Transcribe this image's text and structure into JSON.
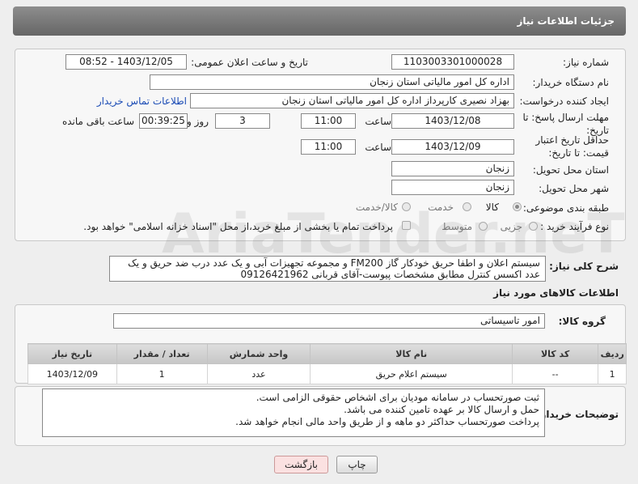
{
  "header": {
    "title": "جزئیات اطلاعات نیاز"
  },
  "form": {
    "need_number_label": "شماره نیاز:",
    "need_number": "1103003301000028",
    "announce_label": "تاریخ و ساعت اعلان عمومی:",
    "announce_value": "1403/12/05 - 08:52",
    "buyer_org_label": "نام دستگاه خریدار:",
    "buyer_org": "اداره کل امور مالیاتی استان زنجان",
    "creator_label": "ایجاد کننده درخواست:",
    "creator": "بهزاد نصیری کارپرداز اداره کل امور مالیاتی استان زنجان",
    "contact_link": "اطلاعات تماس خریدار",
    "deadline_label": "مهلت ارسال پاسخ: تا تاریخ:",
    "deadline_date": "1403/12/08",
    "time_label": "ساعت",
    "deadline_time": "11:00",
    "days_value": "3",
    "days_label": "روز و",
    "remaining_time": "00:39:25",
    "remaining_label": "ساعت باقی مانده",
    "validity_label": "حداقل تاریخ اعتبار قیمت: تا تاریخ:",
    "validity_date": "1403/12/09",
    "validity_time": "11:00",
    "province_label": "استان محل تحویل:",
    "province": "زنجان",
    "city_label": "شهر محل تحویل:",
    "city": "زنجان",
    "category_label": "طبقه بندی موضوعی:",
    "category_options": [
      "کالا",
      "خدمت",
      "کالا/خدمت"
    ],
    "category_selected": "کالا",
    "process_label": "نوع فرآیند خرید :",
    "process_options": [
      "جزیی",
      "متوسط"
    ],
    "process_note": "پرداخت تمام یا بخشی از مبلغ خرید،از محل \"اسناد خزانه اسلامی\" خواهد بود."
  },
  "description": {
    "label": "شرح کلی نیاز:",
    "text": "سیستم اعلان و اطفا حریق خودکار گاز FM200  و مجموعه تجهیزات آبی و یک عدد درب ضد حریق و یک عدد اکسس کنترل مطابق مشخصات پیوست-آقای قربانی 09126421962"
  },
  "goods": {
    "section_title": "اطلاعات کالاهای مورد نیاز",
    "group_label": "گروه کالا:",
    "group_value": "امور تاسیساتی",
    "columns": [
      "ردیف",
      "کد کالا",
      "نام کالا",
      "واحد شمارش",
      "تعداد / مقدار",
      "تاریخ نیاز"
    ],
    "rows": [
      {
        "row": "1",
        "code": "--",
        "name": "سیستم اعلام حریق",
        "unit": "عدد",
        "qty": "1",
        "date": "1403/12/09"
      }
    ]
  },
  "buyer_notes": {
    "label": "توضیحات خریدار:",
    "lines": [
      "ثبت صورتحساب در سامانه مودیان برای اشخاص حقوقی الزامی است.",
      "حمل و ارسال کالا بر عهده تامین کننده می باشد.",
      "پرداخت صورتحساب حداکثر دو ماهه و از طریق واحد مالی انجام خواهد شد."
    ]
  },
  "buttons": {
    "print": "چاپ",
    "back": "بازگشت"
  },
  "watermark": {
    "text": "AriaTender.neT"
  }
}
